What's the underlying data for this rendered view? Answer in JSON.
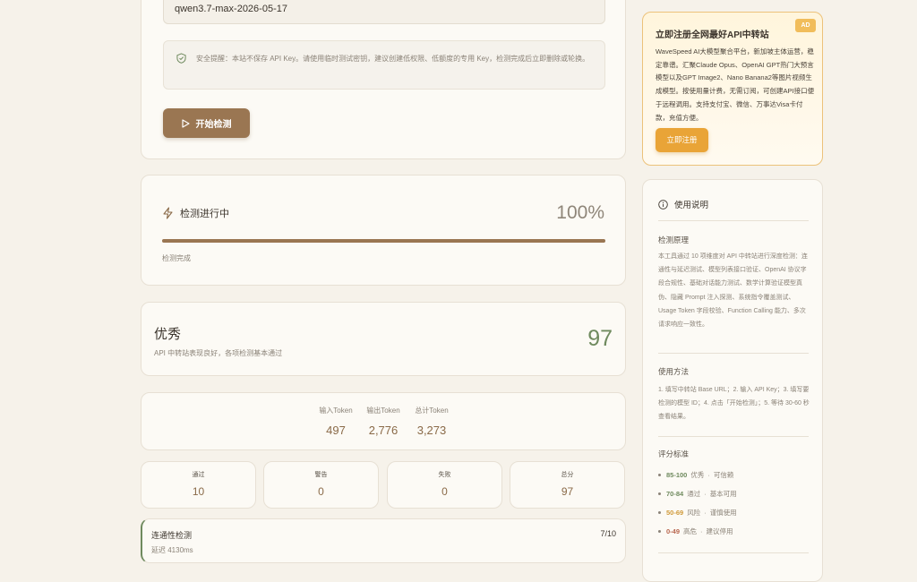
{
  "form": {
    "model_value": "qwen3.7-max-2026-05-17",
    "security_note": "安全提醒：本站不保存 API Key。请使用临时测试密钥，建议创建低权限、低额度的专用 Key，检测完成后立即删除或轮换。",
    "start_button": "开始检测"
  },
  "progress": {
    "title": "检测进行中",
    "percent_text": "100%",
    "percent": 100,
    "status": "检测完成"
  },
  "result": {
    "grade": "优秀",
    "description": "API 中转站表现良好，各项检测基本通过",
    "score": "97"
  },
  "tokens": [
    {
      "label": "输入Token",
      "value": "497"
    },
    {
      "label": "输出Token",
      "value": "2,776"
    },
    {
      "label": "总计Token",
      "value": "3,273"
    }
  ],
  "stats": [
    {
      "label": "通过",
      "value": "10"
    },
    {
      "label": "警告",
      "value": "0"
    },
    {
      "label": "失败",
      "value": "0"
    },
    {
      "label": "总分",
      "value": "97"
    }
  ],
  "connectivity": {
    "title": "连通性检测",
    "subtitle": "延迟 4130ms",
    "count": "7/10"
  },
  "ad": {
    "title": "立即注册全网最好API中转站",
    "badge": "AD",
    "body": "WaveSpeed AI大模型聚合平台，新加坡主体运营，稳定靠谱。汇聚Claude Opus、OpenAI GPT热门大预言模型以及GPT Image2、Nano Banana2等图片视频生成模型。按使用量计费，无需订阅，可创建API接口便于远程调用。支持支付宝、微信、万事达Visa卡付款，充值方便。",
    "button": "立即注册"
  },
  "guide": {
    "title": "使用说明",
    "principle_heading": "检测原理",
    "principle_text": "本工具通过 10 项维度对 API 中转站进行深度检测：连通性与延迟测试、模型列表接口验证、OpenAI 协议字段合规性、基础对话能力测试、数学计算验证模型真伪、隐藏 Prompt 注入探测、系统指令覆盖测试、Usage Token 字段校验、Function Calling 能力、多次请求响应一致性。",
    "usage_heading": "使用方法",
    "usage_text": "1. 填写中转站 Base URL；2. 输入 API Key；3. 填写要检测的模型 ID；4. 点击「开始检测」；5. 等待 30-60 秒查看结果。",
    "criteria_heading": "评分标准",
    "criteria": [
      {
        "range": "85-100",
        "label": "优秀",
        "note": "可信赖",
        "color": "#6f8a5e"
      },
      {
        "range": "70-84",
        "label": "通过",
        "note": "基本可用",
        "color": "#6f8a5e"
      },
      {
        "range": "50-69",
        "label": "风险",
        "note": "谨慎使用",
        "color": "#d09a3a"
      },
      {
        "range": "0-49",
        "label": "高危",
        "note": "建议停用",
        "color": "#b8654d"
      }
    ]
  }
}
